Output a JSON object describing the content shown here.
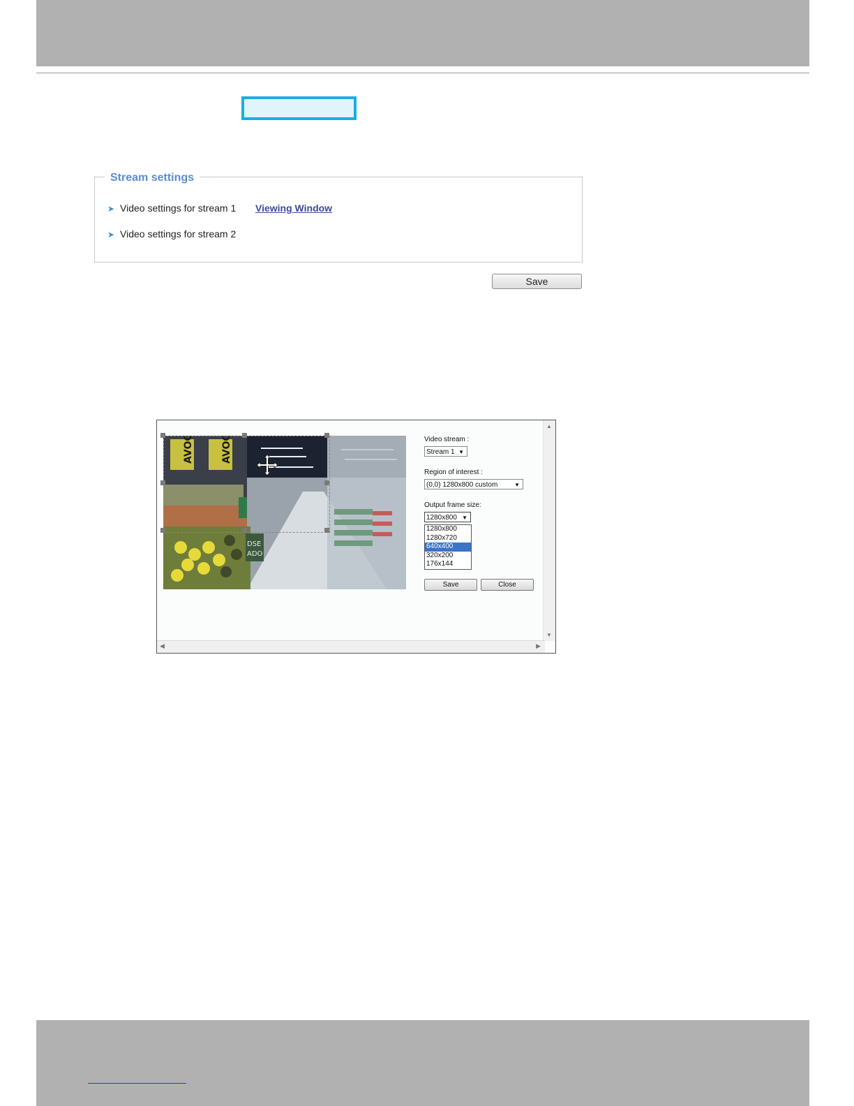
{
  "stream_settings": {
    "legend": "Stream settings",
    "items": [
      {
        "label": "Video settings for stream 1"
      },
      {
        "label": "Video settings for stream 2"
      }
    ],
    "viewing_window_link": "Viewing Window",
    "save_label": "Save"
  },
  "viewing_window": {
    "video_stream_label": "Video stream :",
    "video_stream_value": "Stream 1",
    "roi_label": "Region of interest :",
    "roi_value": "(0,0) 1280x800 custom",
    "output_label": "Output frame size:",
    "output_value": "1280x800",
    "output_options": [
      "1280x800",
      "1280x720",
      "640x400",
      "320x200",
      "176x144"
    ],
    "selected_option": "640x400",
    "save_label": "Save",
    "close_label": "Close",
    "sign_texts": [
      "AVOC",
      "AVOC",
      "DSE",
      "ADO"
    ]
  },
  "colors": {
    "header_footer": "#b1b1b1",
    "highlight_border": "#19aee2",
    "legend": "#5a8ccf",
    "link": "#3d4a9a",
    "selected_option": "#3b73c8"
  }
}
